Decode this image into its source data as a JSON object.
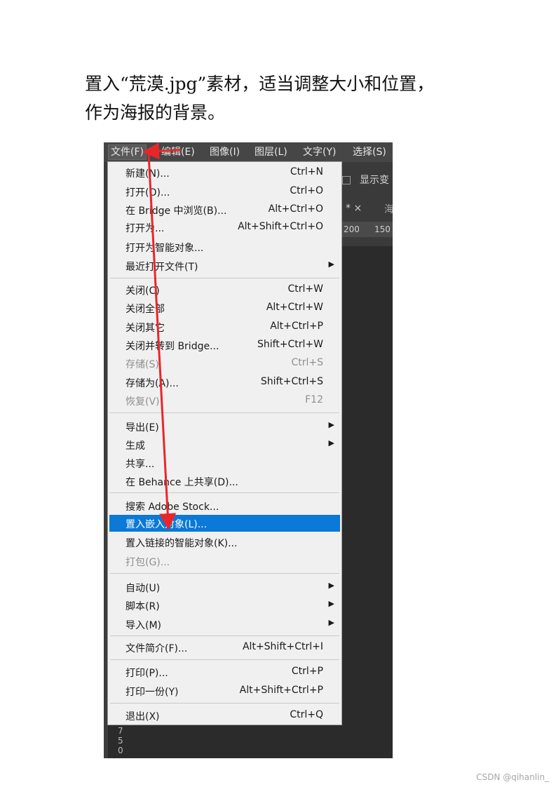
{
  "instruction": {
    "line1": "置入“荒漠.jpg”素材，适当调整大小和位置，",
    "line2": "作为海报的背景。"
  },
  "menubar": [
    "文件(F)",
    "编辑(E)",
    "图像(I)",
    "图层(L)",
    "文字(Y)",
    "选择(S)"
  ],
  "toolbar": {
    "checkbox_label": "显示变",
    "tab_marker": "* ×",
    "tab_next": "海"
  },
  "ruler": [
    "200",
    "150"
  ],
  "side_ruler": [
    "7",
    "5",
    "0"
  ],
  "file_menu": {
    "items": [
      {
        "label": "新建(N)...",
        "shortcut": "Ctrl+N"
      },
      {
        "label": "打开(O)...",
        "shortcut": "Ctrl+O"
      },
      {
        "label": "在 Bridge 中浏览(B)...",
        "shortcut": "Alt+Ctrl+O"
      },
      {
        "label": "打开为...",
        "shortcut": "Alt+Shift+Ctrl+O"
      },
      {
        "label": "打开为智能对象...",
        "shortcut": ""
      },
      {
        "label": "最近打开文件(T)",
        "shortcut": "",
        "submenu": true
      },
      {
        "label": "关闭(C)",
        "shortcut": "Ctrl+W"
      },
      {
        "label": "关闭全部",
        "shortcut": "Alt+Ctrl+W"
      },
      {
        "label": "关闭其它",
        "shortcut": "Alt+Ctrl+P"
      },
      {
        "label": "关闭并转到 Bridge...",
        "shortcut": "Shift+Ctrl+W"
      },
      {
        "label": "存储(S)",
        "shortcut": "Ctrl+S",
        "disabled": true
      },
      {
        "label": "存储为(A)...",
        "shortcut": "Shift+Ctrl+S"
      },
      {
        "label": "恢复(V)",
        "shortcut": "F12",
        "disabled": true
      },
      {
        "label": "导出(E)",
        "shortcut": "",
        "submenu": true
      },
      {
        "label": "生成",
        "shortcut": "",
        "submenu": true
      },
      {
        "label": "共享...",
        "shortcut": ""
      },
      {
        "label": "在 Behance 上共享(D)...",
        "shortcut": ""
      },
      {
        "label": "搜索 Adobe Stock...",
        "shortcut": ""
      },
      {
        "label": "置入嵌入对象(L)...",
        "shortcut": "",
        "highlighted": true
      },
      {
        "label": "置入链接的智能对象(K)...",
        "shortcut": ""
      },
      {
        "label": "打包(G)...",
        "shortcut": "",
        "disabled": true
      },
      {
        "label": "自动(U)",
        "shortcut": "",
        "submenu": true
      },
      {
        "label": "脚本(R)",
        "shortcut": "",
        "submenu": true
      },
      {
        "label": "导入(M)",
        "shortcut": "",
        "submenu": true
      },
      {
        "label": "文件简介(F)...",
        "shortcut": "Alt+Shift+Ctrl+I"
      },
      {
        "label": "打印(P)...",
        "shortcut": "Ctrl+P"
      },
      {
        "label": "打印一份(Y)",
        "shortcut": "Alt+Shift+Ctrl+P"
      },
      {
        "label": "退出(X)",
        "shortcut": "Ctrl+Q"
      }
    ]
  },
  "colors": {
    "highlight": "#0a79d7",
    "arrow": "#e8262a"
  },
  "watermark": "CSDN @qihanlin_"
}
